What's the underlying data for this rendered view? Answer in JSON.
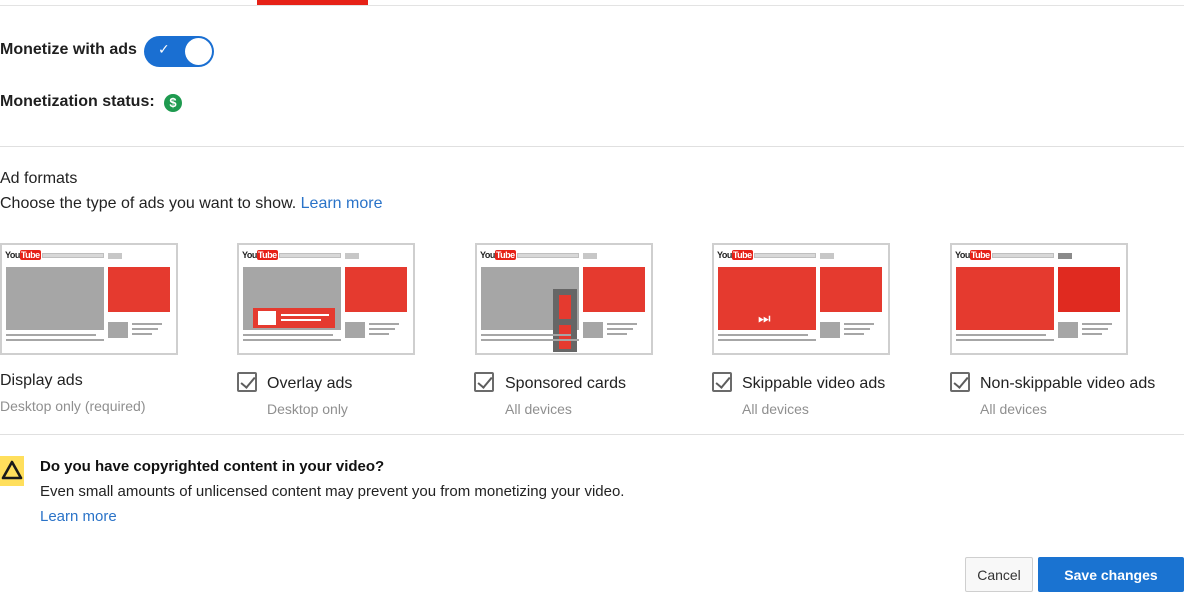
{
  "monetize": {
    "toggle_label": "Monetize with ads",
    "toggle_on": true,
    "toggle_check": "✓",
    "status_label": "Monetization status:",
    "status_icon": "dollar-circle-icon",
    "status_symbol": "$",
    "status_color": "#1e9a4f"
  },
  "ad_formats": {
    "title": "Ad formats",
    "description": "Choose the type of ads you want to show.",
    "learn_more": "Learn more",
    "youtube_logo_you": "You",
    "youtube_logo_tube": "Tube",
    "skip_symbol": "⏭",
    "items": [
      {
        "label": "Display ads",
        "sub": "Desktop only (required)",
        "checkbox": false
      },
      {
        "label": "Overlay ads",
        "sub": "Desktop only",
        "checkbox": true,
        "checked": true
      },
      {
        "label": "Sponsored cards",
        "sub": "All devices",
        "checkbox": true,
        "checked": true
      },
      {
        "label": "Skippable video ads",
        "sub": "All devices",
        "checkbox": true,
        "checked": true
      },
      {
        "label": "Non-skippable video ads",
        "sub": "All devices",
        "checkbox": true,
        "checked": true
      }
    ]
  },
  "copyright": {
    "icon": "warning-icon",
    "title": "Do you have copyrighted content in your video?",
    "text": "Even small amounts of unlicensed content may prevent you from monetizing your video.",
    "learn_more": "Learn more"
  },
  "actions": {
    "cancel": "Cancel",
    "save": "Save changes"
  },
  "colors": {
    "accent_blue": "#1a73d1",
    "youtube_red": "#e62117",
    "ad_red": "#e53a2f",
    "link_blue": "#2a73c8",
    "warning_yellow": "#ffdf5c"
  }
}
